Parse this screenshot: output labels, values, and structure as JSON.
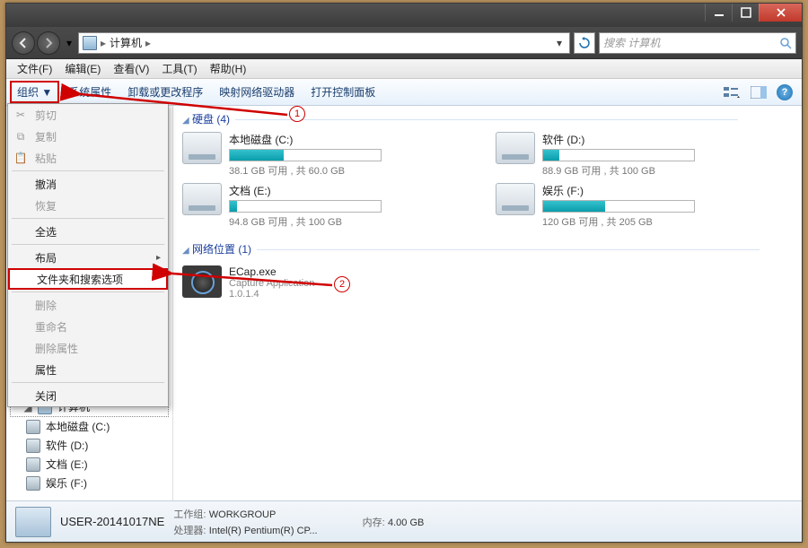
{
  "titlebar": {
    "min": "minimize",
    "max": "maximize",
    "close": "close"
  },
  "nav": {
    "breadcrumb_root": "计算机",
    "sep": "▶",
    "search_placeholder": "搜索 计算机"
  },
  "menubar": [
    "文件(F)",
    "编辑(E)",
    "查看(V)",
    "工具(T)",
    "帮助(H)"
  ],
  "toolbar": {
    "organize": "组织 ▼",
    "items": [
      "系统属性",
      "卸载或更改程序",
      "映射网络驱动器",
      "打开控制面板"
    ]
  },
  "dropdown": [
    {
      "label": "剪切",
      "disabled": true,
      "icon": "cut"
    },
    {
      "label": "复制",
      "disabled": true,
      "icon": "copy"
    },
    {
      "label": "粘贴",
      "disabled": true,
      "icon": "paste"
    },
    {
      "sep": true
    },
    {
      "label": "撤消",
      "disabled": false
    },
    {
      "label": "恢复",
      "disabled": true
    },
    {
      "sep": true
    },
    {
      "label": "全选",
      "disabled": false
    },
    {
      "sep": true
    },
    {
      "label": "布局",
      "disabled": false,
      "submenu": true
    },
    {
      "label": "文件夹和搜索选项",
      "disabled": false,
      "highlight": true
    },
    {
      "sep": true
    },
    {
      "label": "删除",
      "disabled": true
    },
    {
      "label": "重命名",
      "disabled": true
    },
    {
      "label": "删除属性",
      "disabled": true
    },
    {
      "label": "属性",
      "disabled": false
    },
    {
      "sep": true
    },
    {
      "label": "关闭",
      "disabled": false
    }
  ],
  "sidebar": {
    "computer": "计算机",
    "drives": [
      {
        "label": "本地磁盘 (C:)"
      },
      {
        "label": "软件 (D:)"
      },
      {
        "label": "文档 (E:)"
      },
      {
        "label": "娱乐 (F:)"
      }
    ]
  },
  "content": {
    "group_drives": "硬盘 (4)",
    "group_network": "网络位置 (1)",
    "drives": [
      {
        "name": "本地磁盘 (C:)",
        "text": "38.1 GB 可用 , 共 60.0 GB",
        "fill": 36
      },
      {
        "name": "软件 (D:)",
        "text": "88.9 GB 可用 , 共 100 GB",
        "fill": 11
      },
      {
        "name": "文档 (E:)",
        "text": "94.8 GB 可用 , 共 100 GB",
        "fill": 5
      },
      {
        "name": "娱乐 (F:)",
        "text": "120 GB 可用 , 共 205 GB",
        "fill": 41
      }
    ],
    "network": {
      "name": "ECap.exe",
      "desc": "Capture Application",
      "ver": "1.0.1.4"
    }
  },
  "status": {
    "name": "USER-20141017NE",
    "k1": "工作组:",
    "v1": "WORKGROUP",
    "k2": "处理器:",
    "v2": "Intel(R) Pentium(R) CP...",
    "k3": "内存:",
    "v3": "4.00 GB"
  },
  "anno": {
    "a1": "1",
    "a2": "2"
  }
}
